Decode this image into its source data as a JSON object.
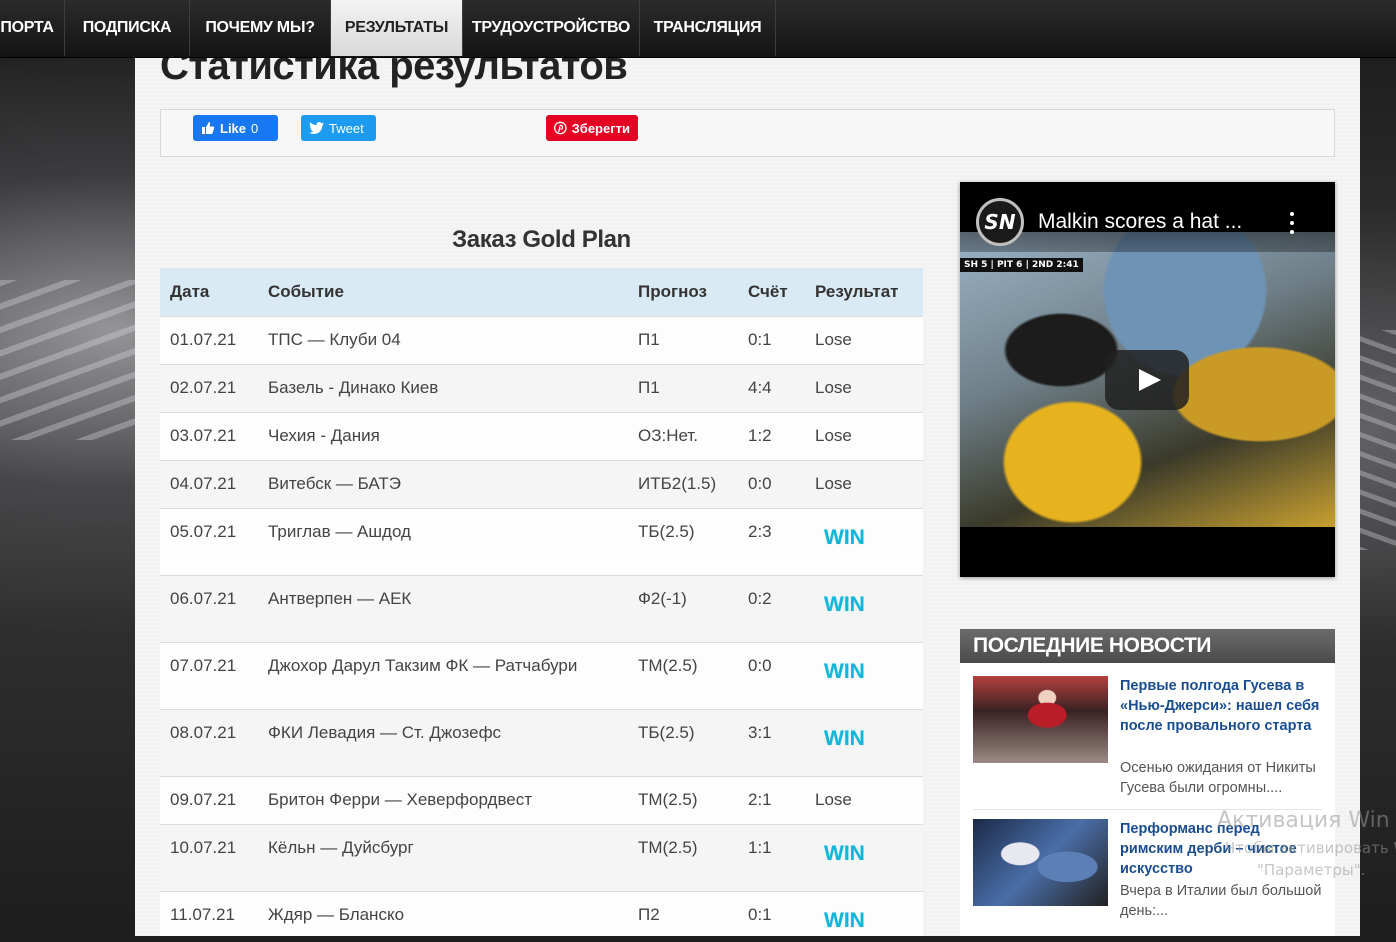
{
  "nav": {
    "items": [
      {
        "label": "ПОРТА",
        "active": false
      },
      {
        "label": "ПОДПИСКА",
        "active": false
      },
      {
        "label": "ПОЧЕМУ МЫ?",
        "active": false
      },
      {
        "label": "РЕЗУЛЬТАТЫ",
        "active": true
      },
      {
        "label": "ТРУДОУСТРОЙСТВО",
        "active": false
      },
      {
        "label": "ТРАНСЛЯЦИЯ",
        "active": false
      }
    ]
  },
  "page": {
    "title": "Статистика результатов"
  },
  "share": {
    "facebook_label": "Like",
    "facebook_count": "0",
    "twitter_label": "Tweet",
    "pinterest_label": "Зберегти"
  },
  "results_section": {
    "title": "Заказ Gold Plan",
    "columns": [
      "Дата",
      "Событие",
      "Прогноз",
      "Счёт",
      "Результат"
    ],
    "rows": [
      {
        "date": "01.07.21",
        "event": "ТПС — Клуби 04",
        "forecast": "П1",
        "score": "0:1",
        "result": "Lose"
      },
      {
        "date": "02.07.21",
        "event": "Базель - Динако Киев",
        "forecast": "П1",
        "score": "4:4",
        "result": "Lose"
      },
      {
        "date": "03.07.21",
        "event": "Чехия - Дания",
        "forecast": "ОЗ:Нет.",
        "score": "1:2",
        "result": "Lose"
      },
      {
        "date": "04.07.21",
        "event": "Витебск — БАТЭ",
        "forecast": "ИТБ2(1.5)",
        "score": "0:0",
        "result": "Lose"
      },
      {
        "date": "05.07.21",
        "event": "Триглав — Ашдод",
        "forecast": "ТБ(2.5)",
        "score": "2:3",
        "result": "WIN"
      },
      {
        "date": "06.07.21",
        "event": "Антверпен — АЕК",
        "forecast": "Ф2(-1)",
        "score": "0:2",
        "result": "WIN"
      },
      {
        "date": "07.07.21",
        "event": "Джохор Дарул Такзим ФК — Ратчабури",
        "forecast": "ТМ(2.5)",
        "score": "0:0",
        "result": "WIN"
      },
      {
        "date": "08.07.21",
        "event": "ФКИ Левадия — Ст. Джозефс",
        "forecast": "ТБ(2.5)",
        "score": "3:1",
        "result": "WIN"
      },
      {
        "date": "09.07.21",
        "event": "Бритон Ферри — Хеверфордвест",
        "forecast": "ТМ(2.5)",
        "score": "2:1",
        "result": "Lose"
      },
      {
        "date": "10.07.21",
        "event": "Кёльн — Дуйсбург",
        "forecast": "ТМ(2.5)",
        "score": "1:1",
        "result": "WIN"
      },
      {
        "date": "11.07.21",
        "event": "Ждяр — Бланско",
        "forecast": "П2",
        "score": "0:1",
        "result": "WIN"
      }
    ]
  },
  "video": {
    "channel_logo": "SN",
    "title": "Malkin scores a hat ...",
    "scorebar": "SH 5 | PIT 6 | 2ND 2:41"
  },
  "news": {
    "header": "ПОСЛЕДНИЕ НОВОСТИ",
    "items": [
      {
        "headline": "Первые полгода Гусева в «Нью-Джерси»: нашел себя после провального старта",
        "excerpt": "Осенью ожидания от Никиты Гусева были огромны...."
      },
      {
        "headline": "Перформанс перед римским дерби – чистое искусство",
        "excerpt": "Вчера в Италии был большой день:..."
      }
    ]
  },
  "watermark": {
    "line1": "Активация Win",
    "line2": "Чтобы активировать W",
    "line3": "\"Параметры\"."
  },
  "colors": {
    "win": "#12b6d8",
    "table_header": "#d9eaf4",
    "news_link": "#1a4d8f",
    "facebook": "#1877f2",
    "twitter": "#1d9bf0",
    "pinterest": "#e60023"
  }
}
